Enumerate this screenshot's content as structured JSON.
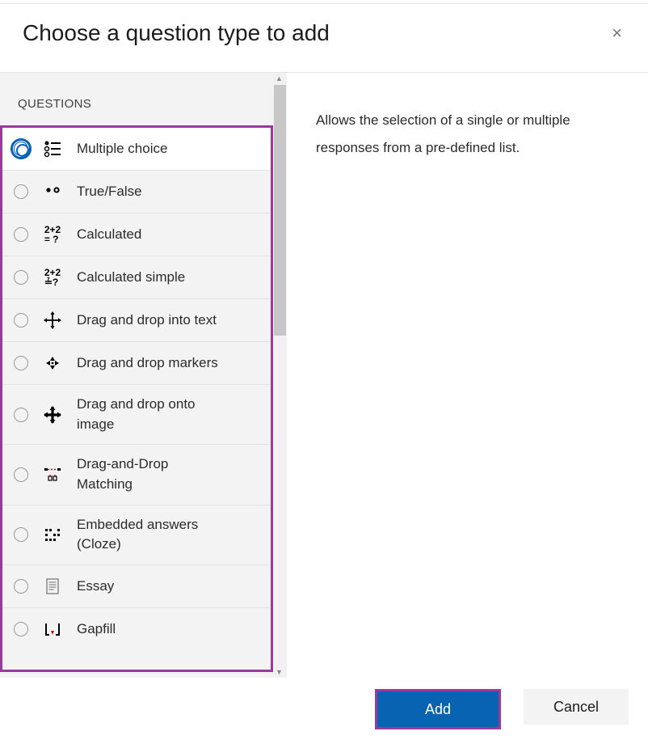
{
  "modal": {
    "title": "Choose a question type to add",
    "section_label": "QUESTIONS"
  },
  "description": "Allows the selection of a single or multiple responses from a pre-defined list.",
  "questiontypes": {
    "multiplechoice": {
      "label": "Multiple choice"
    },
    "truefalse": {
      "label": "True/False"
    },
    "calculated": {
      "label": "Calculated"
    },
    "calculatedsimple": {
      "label": "Calculated simple"
    },
    "dragintotext": {
      "label": "Drag and drop into text"
    },
    "dragmarkers": {
      "label": "Drag and drop markers"
    },
    "dragontoimage": {
      "label": "Drag and drop onto image"
    },
    "dragmatching": {
      "label": "Drag-and-Drop Matching"
    },
    "cloze": {
      "label": "Embedded answers (Cloze)"
    },
    "essay": {
      "label": "Essay"
    },
    "gapfill": {
      "label": "Gapfill"
    }
  },
  "footer": {
    "add_label": "Add",
    "cancel_label": "Cancel"
  }
}
